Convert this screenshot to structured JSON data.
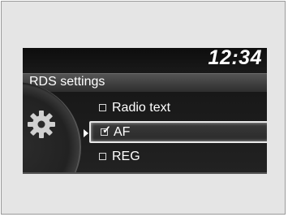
{
  "status": {
    "time": "12:34"
  },
  "header": {
    "title": "RDS settings"
  },
  "menu": {
    "items": [
      {
        "label": "Radio text",
        "checked": false,
        "selected": false
      },
      {
        "label": "AF",
        "checked": true,
        "selected": true
      },
      {
        "label": "REG",
        "checked": false,
        "selected": false
      }
    ]
  },
  "icons": {
    "settings": "gear-icon",
    "selection_pointer": "pointer-icon"
  },
  "colors": {
    "screen_background": "#1c1c1c",
    "text": "#ffffff",
    "highlight_border": "#e8e8e8",
    "frame_background": "#e5e5e5"
  }
}
